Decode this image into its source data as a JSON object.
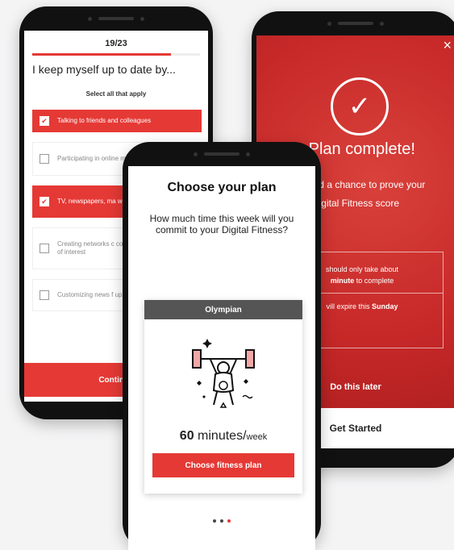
{
  "colors": {
    "accent": "#e53935",
    "card_header": "#555555"
  },
  "survey": {
    "progress_text": "19/23",
    "progress_fraction": 0.826,
    "question": "I keep myself up to date by...",
    "hint": "Select all that apply",
    "options": [
      {
        "label": "Talking to friends and colleagues",
        "selected": true
      },
      {
        "label": "Participating in online my specialist areas",
        "selected": false
      },
      {
        "label": "TV, newspapers, ma websites",
        "selected": true
      },
      {
        "label": "Creating networks c contacts that keep m areas of interest",
        "selected": false
      },
      {
        "label": "Customizing news f up smart alerts",
        "selected": false
      }
    ],
    "continue_label": "Continue"
  },
  "complete": {
    "close_icon": "close-icon",
    "title": "s Plan complete!",
    "subtitle": "e earned a chance to prove your Digital Fitness score",
    "box_line1_a": "should only take about",
    "box_line1_b": "minute",
    "box_line1_c": "to complete",
    "box_line2_a": "vill expire this",
    "box_line2_b": "Sunday",
    "later_label": "Do this later",
    "start_label": "Get Started"
  },
  "plan": {
    "title": "Choose your plan",
    "question": "How much time this week will you commit to your Digital Fitness?",
    "card_title": "Olympian",
    "minutes_value": "60",
    "minutes_word": "minutes/",
    "minutes_unit": "week",
    "button_label": "Choose fitness plan",
    "pager_active_index": 2
  }
}
